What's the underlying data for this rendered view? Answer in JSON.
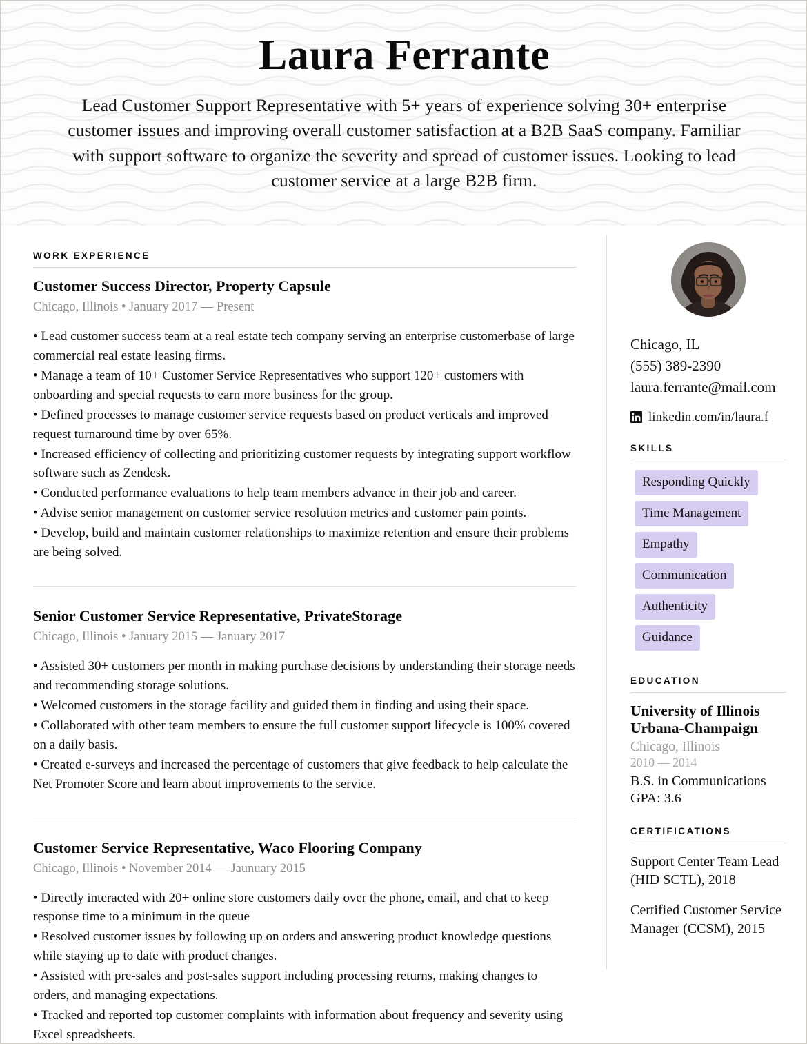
{
  "header": {
    "name": "Laura Ferrante",
    "summary": "Lead Customer Support Representative with 5+ years of experience solving 30+ enterprise customer issues and improving overall customer satisfaction at a B2B SaaS company. Familiar with support software to organize the severity and spread of customer issues. Looking to lead customer service at a large B2B firm."
  },
  "work": {
    "section_label": "WORK EXPERIENCE",
    "jobs": [
      {
        "title": "Customer Success Director, Property Capsule",
        "meta": "Chicago, Illinois • January 2017 — Present",
        "bullets": [
          "• Lead customer success team at a real estate tech company serving an enterprise customerbase of large commercial real estate leasing firms.",
          "• Manage a team of 10+ Customer Service Representatives who support 120+ customers with onboarding and special requests to earn more business for the group.",
          "• Defined processes to manage customer service requests based on product verticals and improved request turnaround time by over 65%.",
          "• Increased efficiency of collecting and prioritizing customer requests by integrating support workflow software such as Zendesk.",
          "• Conducted performance evaluations to help team members advance in their job and career.",
          "• Advise senior management on customer service resolution metrics and customer pain points.",
          "• Develop, build and maintain customer relationships to maximize retention and ensure their problems are being solved."
        ]
      },
      {
        "title": "Senior Customer Service Representative, PrivateStorage",
        "meta": "Chicago, Illinois • January 2015 — January 2017",
        "bullets": [
          "• Assisted 30+ customers per month in making purchase decisions by understanding their storage needs and recommending storage solutions.",
          "• Welcomed customers in the storage facility and guided them in finding and using their space.",
          "• Collaborated with other team members to ensure the full customer support lifecycle is 100% covered on a daily basis.",
          "• Created e-surveys and increased the percentage of customers that give feedback to help calculate the Net Promoter Score and learn about improvements to the service."
        ]
      },
      {
        "title": "Customer Service Representative, Waco Flooring Company",
        "meta": "Chicago, Illinois • November 2014 — Jaunuary 2015",
        "bullets": [
          "• Directly interacted with 20+ online store customers daily over the phone, email, and chat to keep response time to a minimum in the queue",
          "• Resolved customer issues by following up on orders and answering product knowledge questions while staying up to date with product changes.",
          "• Assisted with pre-sales and post-sales support including processing returns, making changes to orders, and managing expectations.",
          "• Tracked and reported top customer complaints with information about frequency and severity using Excel spreadsheets."
        ]
      }
    ]
  },
  "contact": {
    "location": "Chicago, IL",
    "phone": "(555) 389-2390",
    "email": "laura.ferrante@mail.com",
    "linkedin": "linkedin.com/in/laura.f"
  },
  "skills": {
    "section_label": "SKILLS",
    "items": [
      "Responding Quickly",
      "Time Management",
      "Empathy",
      "Communication",
      "Authenticity",
      "Guidance"
    ],
    "pill_color": "#d6cdf0"
  },
  "education": {
    "section_label": "EDUCATION",
    "school": "University of Illinois Urbana-Champaign",
    "location": "Chicago, Illinois",
    "dates": "2010 — 2014",
    "degree": "B.S. in Communications",
    "gpa": "GPA: 3.6"
  },
  "certifications": {
    "section_label": "CERTIFICATIONS",
    "items": [
      "Support Center Team Lead (HID SCTL), 2018",
      "Certified Customer Service Manager (CCSM), 2015"
    ]
  }
}
